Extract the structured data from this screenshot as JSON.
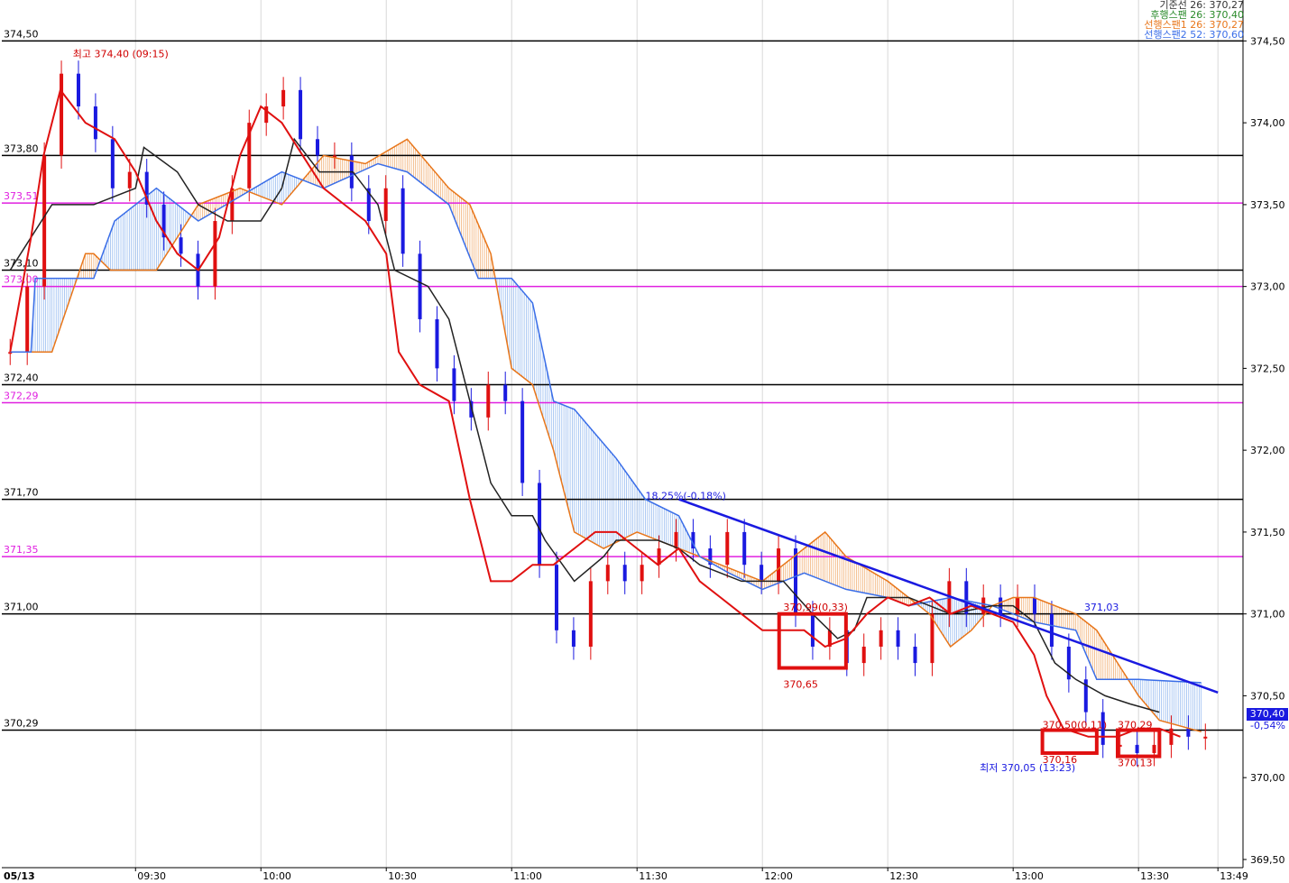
{
  "legend": [
    {
      "text": "기준선 26: 370,27",
      "color": "#333333"
    },
    {
      "text": "후행스팬 26: 370,40",
      "color": "#2a8a2a"
    },
    {
      "text": "선행스팬1 26: 370,27",
      "color": "#e8761a"
    },
    {
      "text": "선행스팬2 52: 370,60",
      "color": "#3a6ee8"
    }
  ],
  "current_price": {
    "label": "370,40",
    "change": "-0,54%"
  },
  "chart_data": {
    "type": "candlestick",
    "title": "",
    "date_label": "05/13",
    "x_ticks": [
      "09:30",
      "10:00",
      "10:30",
      "11:00",
      "11:30",
      "12:00",
      "12:30",
      "13:00",
      "13:30",
      "13:49"
    ],
    "y_ticks": [
      "374,50",
      "374,00",
      "373,50",
      "373,00",
      "372,50",
      "372,00",
      "371,50",
      "371,00",
      "370,50",
      "370,00",
      "369,50"
    ],
    "ylim": [
      369.5,
      374.6
    ],
    "horizontal_lines": [
      {
        "value": 374.5,
        "label": "374,50",
        "color": "#000000"
      },
      {
        "value": 373.8,
        "label": "373,80",
        "color": "#000000"
      },
      {
        "value": 373.51,
        "label": "373,51",
        "color": "#e020e0"
      },
      {
        "value": 373.1,
        "label": "373,10",
        "color": "#000000"
      },
      {
        "value": 373.0,
        "label": "373,00",
        "color": "#e020e0"
      },
      {
        "value": 372.4,
        "label": "372,40",
        "color": "#000000"
      },
      {
        "value": 372.29,
        "label": "372,29",
        "color": "#e020e0"
      },
      {
        "value": 371.7,
        "label": "371,70",
        "color": "#000000"
      },
      {
        "value": 371.35,
        "label": "371,35",
        "color": "#e020e0"
      },
      {
        "value": 371.0,
        "label": "371,00",
        "color": "#000000"
      },
      {
        "value": 370.29,
        "label": "370,29",
        "color": "#000000"
      }
    ],
    "annotations": [
      {
        "text": "최고 374,40 (09:15)",
        "time": "09:15",
        "value": 374.4,
        "color": "#d00000"
      },
      {
        "text": "18,25%(-0,18%)",
        "time": "11:32",
        "value": 371.7,
        "color": "#1a1ae0"
      },
      {
        "text": "370,99(0,33)",
        "time": "12:05",
        "value": 371.02,
        "color": "#d00000"
      },
      {
        "text": "370,65",
        "time": "12:05",
        "value": 370.55,
        "color": "#d00000"
      },
      {
        "text": "371,03",
        "time": "13:17",
        "value": 371.02,
        "color": "#1a1ae0"
      },
      {
        "text": "370,50(0,11)",
        "time": "13:07",
        "value": 370.3,
        "color": "#d00000"
      },
      {
        "text": "370,16",
        "time": "13:07",
        "value": 370.09,
        "color": "#d00000"
      },
      {
        "text": "370,29",
        "time": "13:25",
        "value": 370.3,
        "color": "#d00000"
      },
      {
        "text": "370,13",
        "time": "13:25",
        "value": 370.07,
        "color": "#d00000"
      },
      {
        "text": "최저 370,05 (13:23)",
        "time": "12:52",
        "value": 370.04,
        "color": "#1a1ae0"
      }
    ],
    "highlight_boxes": [
      {
        "t0": "12:04",
        "t1": "12:20",
        "v0": 371.0,
        "v1": 370.67
      },
      {
        "t0": "13:07",
        "t1": "13:20",
        "v0": 370.29,
        "v1": 370.15
      },
      {
        "t0": "13:25",
        "t1": "13:35",
        "v0": 370.29,
        "v1": 370.13
      }
    ],
    "trendline": {
      "t0": "11:40",
      "v0": 371.7,
      "t1": "13:49",
      "v1": 370.52,
      "color": "#1a1ae0"
    },
    "series": {
      "kijun": {
        "color": "#222222",
        "points": [
          [
            "09:00",
            373.1
          ],
          [
            "09:05",
            373.3
          ],
          [
            "09:10",
            373.5
          ],
          [
            "09:20",
            373.5
          ],
          [
            "09:30",
            373.6
          ],
          [
            "09:32",
            373.85
          ],
          [
            "09:40",
            373.7
          ],
          [
            "09:45",
            373.5
          ],
          [
            "09:52",
            373.4
          ],
          [
            "10:00",
            373.4
          ],
          [
            "10:05",
            373.6
          ],
          [
            "10:08",
            373.9
          ],
          [
            "10:14",
            373.7
          ],
          [
            "10:22",
            373.7
          ],
          [
            "10:28",
            373.5
          ],
          [
            "10:32",
            373.1
          ],
          [
            "10:40",
            373.0
          ],
          [
            "10:45",
            372.8
          ],
          [
            "10:50",
            372.3
          ],
          [
            "10:55",
            371.8
          ],
          [
            "11:00",
            371.6
          ],
          [
            "11:05",
            371.6
          ],
          [
            "11:08",
            371.45
          ],
          [
            "11:15",
            371.2
          ],
          [
            "11:22",
            371.35
          ],
          [
            "11:25",
            371.45
          ],
          [
            "11:35",
            371.45
          ],
          [
            "11:40",
            371.4
          ],
          [
            "11:45",
            371.3
          ],
          [
            "11:55",
            371.2
          ],
          [
            "12:05",
            371.2
          ],
          [
            "12:12",
            371.0
          ],
          [
            "12:18",
            370.85
          ],
          [
            "12:22",
            370.9
          ],
          [
            "12:25",
            371.1
          ],
          [
            "12:35",
            371.1
          ],
          [
            "12:45",
            371.0
          ],
          [
            "12:55",
            371.05
          ],
          [
            "13:00",
            371.05
          ],
          [
            "13:05",
            370.95
          ],
          [
            "13:10",
            370.7
          ],
          [
            "13:15",
            370.6
          ],
          [
            "13:22",
            370.5
          ],
          [
            "13:28",
            370.45
          ],
          [
            "13:35",
            370.4
          ]
        ]
      },
      "tenkan": {
        "color": "#e01010",
        "points": [
          [
            "09:00",
            372.6
          ],
          [
            "09:05",
            373.3
          ],
          [
            "09:08",
            373.8
          ],
          [
            "09:12",
            374.2
          ],
          [
            "09:18",
            374.0
          ],
          [
            "09:25",
            373.9
          ],
          [
            "09:30",
            373.7
          ],
          [
            "09:35",
            373.4
          ],
          [
            "09:40",
            373.2
          ],
          [
            "09:45",
            373.1
          ],
          [
            "09:50",
            373.3
          ],
          [
            "09:55",
            373.8
          ],
          [
            "10:00",
            374.1
          ],
          [
            "10:05",
            374.0
          ],
          [
            "10:10",
            373.8
          ],
          [
            "10:15",
            373.6
          ],
          [
            "10:20",
            373.5
          ],
          [
            "10:25",
            373.4
          ],
          [
            "10:30",
            373.2
          ],
          [
            "10:33",
            372.6
          ],
          [
            "10:38",
            372.4
          ],
          [
            "10:45",
            372.3
          ],
          [
            "10:50",
            371.7
          ],
          [
            "10:55",
            371.2
          ],
          [
            "11:00",
            371.2
          ],
          [
            "11:05",
            371.3
          ],
          [
            "11:10",
            371.3
          ],
          [
            "11:15",
            371.4
          ],
          [
            "11:20",
            371.5
          ],
          [
            "11:25",
            371.5
          ],
          [
            "11:30",
            371.4
          ],
          [
            "11:35",
            371.3
          ],
          [
            "11:40",
            371.4
          ],
          [
            "11:45",
            371.2
          ],
          [
            "11:50",
            371.1
          ],
          [
            "11:55",
            371.0
          ],
          [
            "12:00",
            370.9
          ],
          [
            "12:05",
            370.9
          ],
          [
            "12:10",
            370.9
          ],
          [
            "12:15",
            370.8
          ],
          [
            "12:20",
            370.85
          ],
          [
            "12:25",
            371.0
          ],
          [
            "12:30",
            371.1
          ],
          [
            "12:35",
            371.05
          ],
          [
            "12:40",
            371.1
          ],
          [
            "12:45",
            371.0
          ],
          [
            "12:50",
            371.05
          ],
          [
            "12:55",
            371.0
          ],
          [
            "13:00",
            370.95
          ],
          [
            "13:05",
            370.75
          ],
          [
            "13:08",
            370.5
          ],
          [
            "13:12",
            370.3
          ],
          [
            "13:18",
            370.25
          ],
          [
            "13:25",
            370.25
          ],
          [
            "13:30",
            370.3
          ],
          [
            "13:35",
            370.3
          ],
          [
            "13:40",
            370.25
          ]
        ]
      },
      "span1": {
        "color": "#e8761a",
        "points": [
          [
            "09:00",
            372.6
          ],
          [
            "09:10",
            372.6
          ],
          [
            "09:18",
            373.2
          ],
          [
            "09:20",
            373.2
          ],
          [
            "09:24",
            373.1
          ],
          [
            "09:35",
            373.1
          ],
          [
            "09:45",
            373.5
          ],
          [
            "09:55",
            373.6
          ],
          [
            "10:05",
            373.5
          ],
          [
            "10:15",
            373.8
          ],
          [
            "10:25",
            373.75
          ],
          [
            "10:35",
            373.9
          ],
          [
            "10:45",
            373.6
          ],
          [
            "10:50",
            373.5
          ],
          [
            "10:55",
            373.2
          ],
          [
            "11:00",
            372.5
          ],
          [
            "11:05",
            372.4
          ],
          [
            "11:10",
            372.0
          ],
          [
            "11:15",
            371.5
          ],
          [
            "11:22",
            371.4
          ],
          [
            "11:30",
            371.5
          ],
          [
            "11:40",
            371.4
          ],
          [
            "11:50",
            371.3
          ],
          [
            "12:00",
            371.2
          ],
          [
            "12:10",
            371.4
          ],
          [
            "12:15",
            371.5
          ],
          [
            "12:20",
            371.35
          ],
          [
            "12:30",
            371.2
          ],
          [
            "12:40",
            371.0
          ],
          [
            "12:45",
            370.8
          ],
          [
            "12:50",
            370.9
          ],
          [
            "12:55",
            371.05
          ],
          [
            "13:00",
            371.1
          ],
          [
            "13:05",
            371.1
          ],
          [
            "13:10",
            371.05
          ],
          [
            "13:15",
            371.0
          ],
          [
            "13:20",
            370.9
          ],
          [
            "13:25",
            370.7
          ],
          [
            "13:30",
            370.5
          ],
          [
            "13:35",
            370.35
          ],
          [
            "13:45",
            370.28
          ]
        ]
      },
      "span2": {
        "color": "#3a6ee8",
        "points": [
          [
            "09:00",
            372.6
          ],
          [
            "09:05",
            372.6
          ],
          [
            "09:06",
            373.05
          ],
          [
            "09:20",
            373.05
          ],
          [
            "09:25",
            373.4
          ],
          [
            "09:35",
            373.6
          ],
          [
            "09:45",
            373.4
          ],
          [
            "10:05",
            373.7
          ],
          [
            "10:15",
            373.6
          ],
          [
            "10:28",
            373.75
          ],
          [
            "10:35",
            373.7
          ],
          [
            "10:45",
            373.5
          ],
          [
            "10:52",
            373.05
          ],
          [
            "11:00",
            373.05
          ],
          [
            "11:05",
            372.9
          ],
          [
            "11:10",
            372.3
          ],
          [
            "11:15",
            372.25
          ],
          [
            "11:20",
            372.1
          ],
          [
            "11:25",
            371.95
          ],
          [
            "11:32",
            371.7
          ],
          [
            "11:40",
            371.6
          ],
          [
            "11:45",
            371.35
          ],
          [
            "11:52",
            371.25
          ],
          [
            "12:00",
            371.15
          ],
          [
            "12:10",
            371.25
          ],
          [
            "12:20",
            371.15
          ],
          [
            "12:30",
            371.1
          ],
          [
            "12:35",
            371.05
          ],
          [
            "12:45",
            371.1
          ],
          [
            "12:55",
            371.05
          ],
          [
            "13:05",
            370.95
          ],
          [
            "13:15",
            370.9
          ],
          [
            "13:20",
            370.6
          ],
          [
            "13:30",
            370.6
          ],
          [
            "13:45",
            370.58
          ]
        ]
      },
      "candles": {
        "up_color": "#e01010",
        "down_color": "#1a1ae0",
        "values": [
          372.6,
          373.0,
          373.8,
          374.3,
          374.1,
          373.9,
          373.6,
          373.7,
          373.5,
          373.3,
          373.2,
          373.0,
          373.4,
          373.6,
          374.0,
          374.1,
          374.2,
          373.9,
          373.8,
          373.8,
          373.6,
          373.4,
          373.6,
          373.2,
          372.8,
          372.5,
          372.3,
          372.2,
          372.4,
          372.3,
          371.8,
          371.3,
          370.9,
          370.8,
          371.2,
          371.3,
          371.2,
          371.3,
          371.4,
          371.5,
          371.4,
          371.3,
          371.5,
          371.3,
          371.2,
          371.4,
          371.0,
          370.8,
          370.9,
          370.7,
          370.8,
          370.9,
          370.8,
          370.7,
          371.0,
          371.2,
          371.0,
          371.1,
          371.0,
          371.1,
          371.0,
          370.8,
          370.6,
          370.4,
          370.2,
          370.2,
          370.15,
          370.2,
          370.3,
          370.25,
          370.25
        ]
      }
    }
  }
}
